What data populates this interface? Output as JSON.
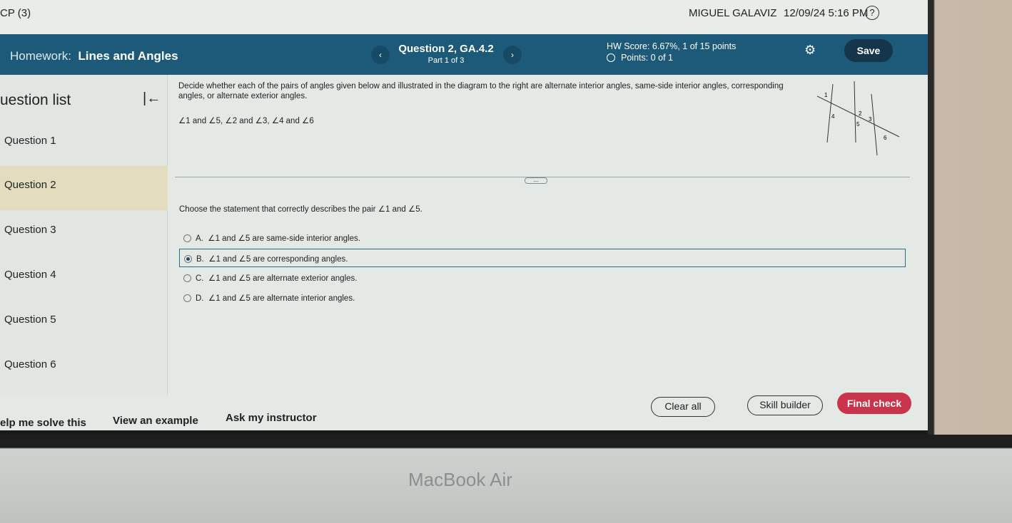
{
  "topbar": {
    "course": "CP (3)",
    "user": "MIGUEL GALAVIZ",
    "datetime": "12/09/24 5:16 PM",
    "help_icon": "?"
  },
  "header": {
    "homework_prefix": "Homework:",
    "homework_title": "Lines and Angles",
    "prev": "‹",
    "next": "›",
    "question_title": "Question 2, GA.4.2",
    "part": "Part 1 of 3",
    "hw_score": "HW Score: 6.67%, 1 of 15 points",
    "points": "Points: 0 of 1",
    "gear_icon": "⚙",
    "save": "Save"
  },
  "sidebar": {
    "title": "uestion list",
    "collapse_icon": "|←",
    "items": [
      "Question 1",
      "Question 2",
      "Question 3",
      "Question 4",
      "Question 5",
      "Question 6"
    ],
    "active_index": 1
  },
  "main": {
    "instructions": "Decide whether each of the pairs of angles given below and illustrated in the diagram to the right are alternate interior angles, same-side interior angles, corresponding angles, or alternate exterior angles.",
    "pairs": "∠1 and ∠5, ∠2 and ∠3, ∠4 and ∠6",
    "diagram_labels": [
      "1",
      "2",
      "3",
      "4",
      "5",
      "6"
    ],
    "more": "...",
    "prompt": "Choose the statement that correctly describes the pair ∠1 and ∠5.",
    "options": [
      {
        "letter": "A.",
        "text": "∠1 and ∠5 are same-side interior angles."
      },
      {
        "letter": "B.",
        "text": "∠1 and ∠5 are corresponding angles."
      },
      {
        "letter": "C.",
        "text": "∠1 and ∠5 are alternate exterior angles."
      },
      {
        "letter": "D.",
        "text": "∠1 and ∠5 are alternate interior angles."
      }
    ],
    "selected_option": "B."
  },
  "footer": {
    "help_solve": "elp me solve this",
    "view_example": "View an example",
    "ask_instructor": "Ask my instructor",
    "clear_all": "Clear all",
    "skill_builder": "Skill builder",
    "final_check": "Final check"
  },
  "device": {
    "brand": "MacBook Air"
  },
  "colors": {
    "header": "#1d5a79",
    "save": "#15364a",
    "final_check": "#c9344a",
    "active_question": "#e4dcbf"
  }
}
